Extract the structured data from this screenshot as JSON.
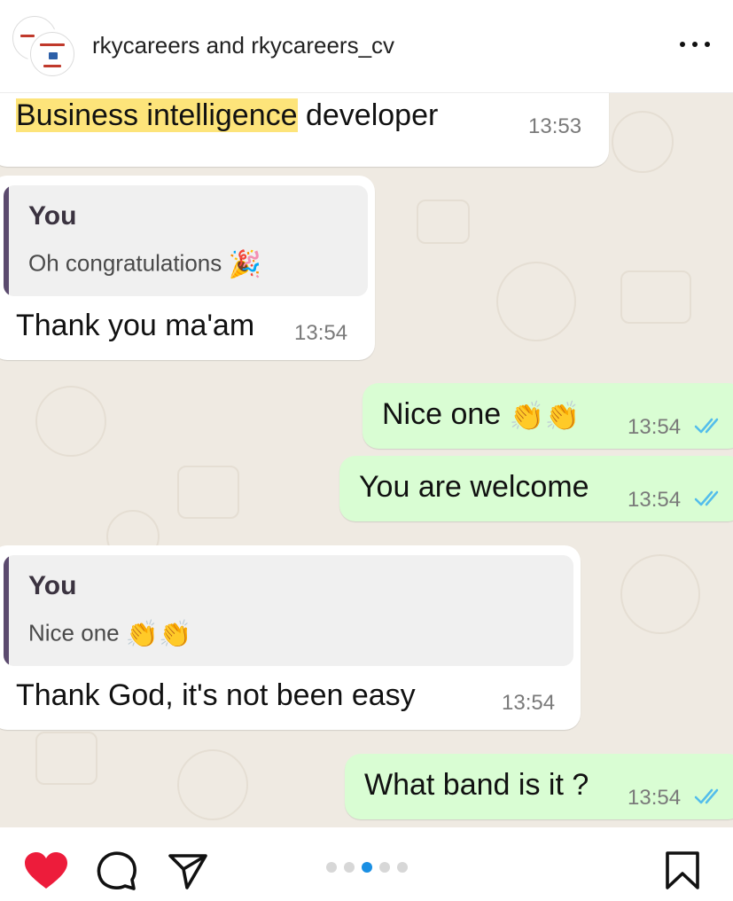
{
  "header": {
    "account_1": "rkycareers",
    "joiner": "and",
    "account_2": "rkycareers_cv"
  },
  "messages": [
    {
      "side": "in",
      "text_highlight": "Business intelligence",
      "text_rest": " developer",
      "time": "13:53"
    },
    {
      "side": "in",
      "quote_author": "You",
      "quote_text": "Oh congratulations",
      "quote_emoji": "🎉",
      "text": "Thank you ma'am",
      "time": "13:54"
    },
    {
      "side": "out",
      "text": "Nice one",
      "emoji": "👏👏",
      "time": "13:54",
      "status": "read"
    },
    {
      "side": "out",
      "text": "You are welcome",
      "time": "13:54",
      "status": "read"
    },
    {
      "side": "in",
      "quote_author": "You",
      "quote_text": "Nice one",
      "quote_emoji": "👏👏",
      "text": "Thank God, it's not been easy",
      "time": "13:54"
    },
    {
      "side": "out",
      "text": "What band is it ?",
      "time": "13:54",
      "status": "read"
    }
  ],
  "carousel": {
    "count": 5,
    "active_index": 2
  },
  "colors": {
    "like": "#ed1c3b",
    "tick": "#53bdeb",
    "outgoing": "#d9fdd3",
    "highlight": "#fde47a"
  },
  "icons": [
    "heart-icon",
    "comment-icon",
    "share-icon",
    "bookmark-icon",
    "more-icon"
  ]
}
